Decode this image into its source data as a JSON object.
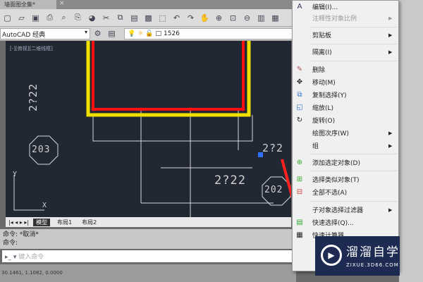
{
  "title_tab": {
    "label": "墙面图全集*",
    "close": "×"
  },
  "workspace": {
    "value": "AutoCAD 经典"
  },
  "layer": {
    "value": "1526"
  },
  "viewport_label": "[-][俯视][二维线框]",
  "drawing": {
    "labels": [
      "2?22",
      "203",
      "2?2",
      "2?22",
      "202"
    ],
    "ucs_y": "Y",
    "ucs_x": "X"
  },
  "layout_tabs": [
    "模型",
    "布局1",
    "布局2"
  ],
  "command": {
    "history": [
      "命令: *取消*",
      "命令:"
    ],
    "placeholder": "键入命令"
  },
  "status": "30.1461, 1.1082, 0.0000",
  "context_menu": [
    {
      "label": "编辑(I)...",
      "icon": "A"
    },
    {
      "label": "注释性对象比例",
      "disabled": true,
      "submenu": true
    },
    {
      "label": "剪贴板",
      "submenu": true
    },
    {
      "label": "隔离(I)",
      "submenu": true
    },
    {
      "label": "删除",
      "icon": "✎"
    },
    {
      "label": "移动(M)",
      "icon": "✥"
    },
    {
      "label": "复制选择(Y)",
      "icon": "⧉"
    },
    {
      "label": "缩放(L)",
      "icon": "◱"
    },
    {
      "label": "旋转(O)",
      "icon": "↻"
    },
    {
      "label": "绘图次序(W)",
      "submenu": true
    },
    {
      "label": "组",
      "submenu": true
    },
    {
      "label": "添加选定对象(D)",
      "icon": "⊕"
    },
    {
      "label": "选择类似对象(T)",
      "icon": "⊞"
    },
    {
      "label": "全部不选(A)",
      "icon": "⊟"
    },
    {
      "label": "子对象选择过滤器",
      "submenu": true
    },
    {
      "label": "快速选择(Q)...",
      "icon": "▤"
    },
    {
      "label": "快速计算器",
      "icon": "▦"
    }
  ],
  "watermark": {
    "title": "溜溜自学",
    "url": "ZIXUE.3D66.COM"
  },
  "colors": {
    "canvas": "#212733",
    "yellow": "#f0e000",
    "red": "#ff1010",
    "menu": "#f0f0f0"
  }
}
